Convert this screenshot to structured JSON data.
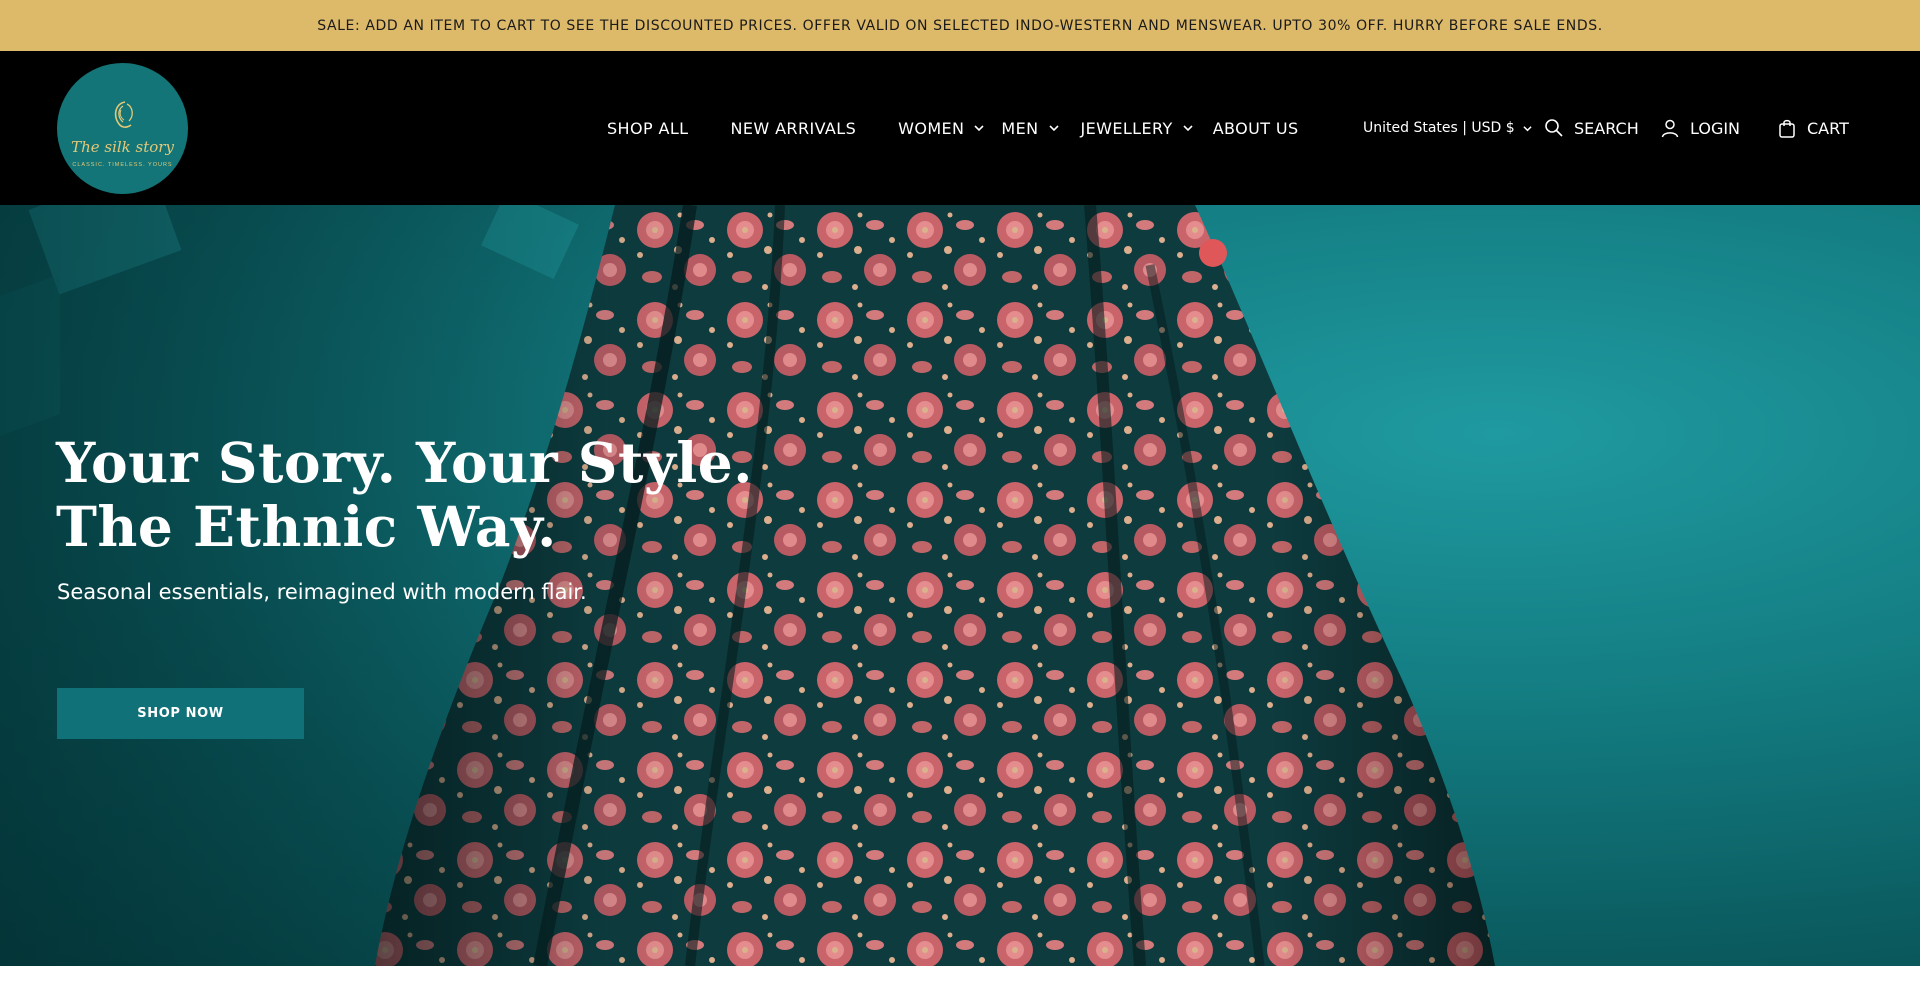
{
  "announcement": {
    "text": "SALE: ADD AN ITEM TO CART TO SEE THE DISCOUNTED PRICES. OFFER VALID ON SELECTED INDO-WESTERN AND MENSWEAR. UPTO 30% OFF. HURRY BEFORE SALE ENDS."
  },
  "header": {
    "logo": {
      "brand": "The silk story",
      "tagline": "CLASSIC. TIMELESS. YOURS",
      "icon": "hair-silhouette-icon"
    },
    "nav": [
      {
        "label": "SHOP ALL"
      },
      {
        "label": "NEW ARRIVALS"
      },
      {
        "label": "WOMEN",
        "has_dropdown": true
      },
      {
        "label": "MEN",
        "has_dropdown": true
      },
      {
        "label": "JEWELLERY",
        "has_dropdown": true
      },
      {
        "label": "ABOUT US"
      }
    ],
    "country_selector": {
      "label": "United States | USD $"
    },
    "search": {
      "label": "SEARCH",
      "icon": "search-icon"
    },
    "login": {
      "label": "LOGIN",
      "icon": "user-icon"
    },
    "cart": {
      "label": "CART",
      "icon": "shopping-bag-icon"
    }
  },
  "hero": {
    "title_line1": "Your Story. Your Style.",
    "title_line2": "The Ethnic Way.",
    "subtitle": "Seasonal essentials, reimagined with modern flair.",
    "button": "SHOP NOW"
  },
  "colors": {
    "announcement_bg": "#ddb96a",
    "header_bg": "#000000",
    "logo_bg": "#137577",
    "accent_gold": "#e3c878",
    "button_bg": "#107278",
    "hero_teal": "#137d82",
    "lehenga_pink": "#c9646b",
    "lehenga_dark": "#0c3a3c"
  }
}
